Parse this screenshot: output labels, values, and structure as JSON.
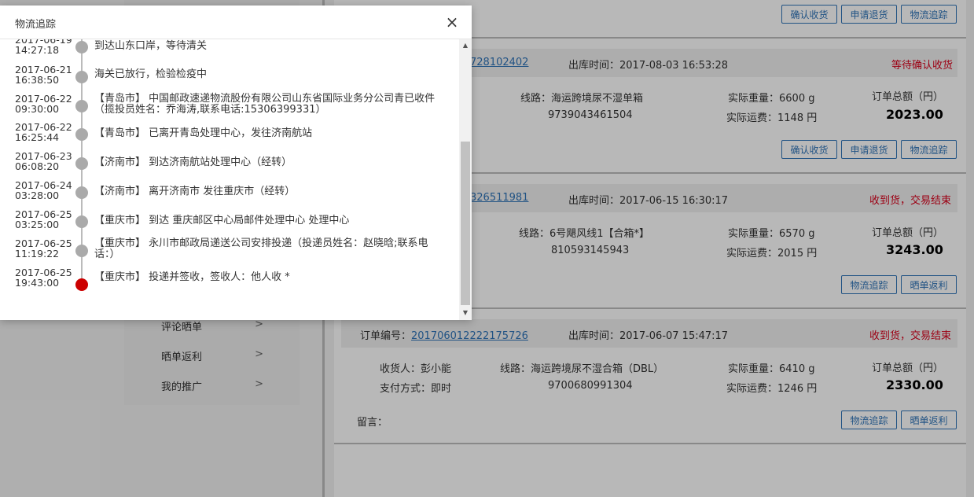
{
  "menu": {
    "items": [
      {
        "label": "评论晒单",
        "arrow": ">"
      },
      {
        "label": "晒单返利",
        "arrow": ">"
      },
      {
        "label": "我的推广",
        "arrow": ">"
      }
    ]
  },
  "orders": [
    {
      "buttons": [
        "确认收货",
        "申请退货",
        "物流追踪"
      ]
    },
    {
      "order_no_suffix": "728102402",
      "ship_time": "出库时间：2017-08-03 16:53:28",
      "status": "等待确认收货",
      "route": "线路：海运跨境尿不湿单箱",
      "tracking": "9739043461504",
      "weight": "实际重量：6600 g",
      "freight": "实际运费：1148 円",
      "total_label": "订单总额（円）",
      "total": "2023.00",
      "buttons": [
        "确认收货",
        "申请退货",
        "物流追踪"
      ]
    },
    {
      "order_no_suffix": "326511981",
      "ship_time": "出库时间：2017-06-15 16:30:17",
      "status": "收到货，交易结束",
      "route": "线路：6号飓风线1【合箱*】",
      "tracking": "810593145943",
      "weight": "实际重量：6570 g",
      "freight": "实际运费：2015 円",
      "total_label": "订单总额（円）",
      "total": "3243.00",
      "buttons": [
        "物流追踪",
        "晒单返利"
      ]
    },
    {
      "order_no_label": "订单编号：",
      "order_no": "201706012222175726",
      "ship_time": "出库时间：2017-06-07 15:47:17",
      "status": "收到货，交易结束",
      "receiver": "收货人：彭小能",
      "payment": "支付方式：即时",
      "route": "线路：海运跨境尿不湿合箱（DBL）",
      "tracking": "9700680991304",
      "weight": "实际重量：6410 g",
      "freight": "实际运费：1246 円",
      "total_label": "订单总额（円）",
      "total": "2330.00",
      "message_label": "留言：",
      "buttons": [
        "物流追踪",
        "晒单返利"
      ]
    }
  ],
  "modal": {
    "title": "物流追踪",
    "close": "×",
    "events": [
      {
        "date": "2017-06-19",
        "time": "14:27:18",
        "text": "到达山东口岸，等待清关"
      },
      {
        "date": "2017-06-21",
        "time": "16:38:50",
        "text": "海关已放行，检验检疫中"
      },
      {
        "date": "2017-06-22",
        "time": "09:30:00",
        "text": "【青岛市】 中国邮政速递物流股份有限公司山东省国际业务分公司青已收件（揽投员姓名：乔海涛,联系电话:15306399331）"
      },
      {
        "date": "2017-06-22",
        "time": "16:25:44",
        "text": "【青岛市】 已离开青岛处理中心，发往济南航站"
      },
      {
        "date": "2017-06-23",
        "time": "06:08:20",
        "text": "【济南市】 到达济南航站处理中心（经转）"
      },
      {
        "date": "2017-06-24",
        "time": "03:28:00",
        "text": "【济南市】 离开济南市 发往重庆市（经转）"
      },
      {
        "date": "2017-06-25",
        "time": "03:25:00",
        "text": "【重庆市】 到达 重庆邮区中心局邮件处理中心 处理中心"
      },
      {
        "date": "2017-06-25",
        "time": "11:19:22",
        "text": "【重庆市】 永川市邮政局递送公司安排投递（投递员姓名：赵晓晗;联系电话：）"
      },
      {
        "date": "2017-06-25",
        "time": "19:43:00",
        "text": "【重庆市】 投递并签收，签收人：他人收 *"
      }
    ]
  },
  "colors": {
    "accent": "#2e73b8",
    "status_red": "#d9001b",
    "last_dot": "#cc0000"
  }
}
